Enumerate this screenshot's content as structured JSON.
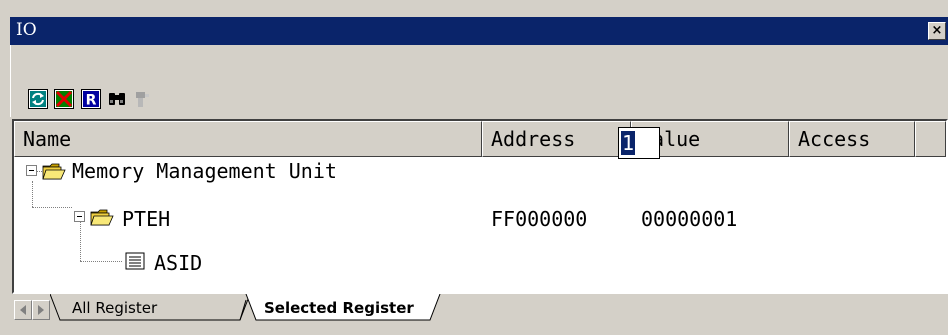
{
  "window": {
    "title": "IO",
    "close_label": "×"
  },
  "toolbar": {
    "buttons": [
      {
        "icon": "refresh-icon"
      },
      {
        "icon": "stop-icon"
      },
      {
        "icon": "register-icon",
        "glyph": "R"
      },
      {
        "icon": "binoculars-icon"
      },
      {
        "icon": "disabled-tool-icon"
      }
    ]
  },
  "columns": [
    "Name",
    "Address",
    "Value",
    "Access"
  ],
  "rows": [
    {
      "name": "Memory Management Unit",
      "address": "",
      "value": ""
    },
    {
      "name": "PTEH",
      "address": "FF000000",
      "value": "00000001"
    },
    {
      "name": "ASID",
      "address": "",
      "value": "1"
    }
  ],
  "tabs": [
    "All Register",
    "Selected Register"
  ],
  "colors": {
    "titlebar": "#0a246a",
    "face": "#d4d0c8",
    "selection": "#0a246a"
  }
}
